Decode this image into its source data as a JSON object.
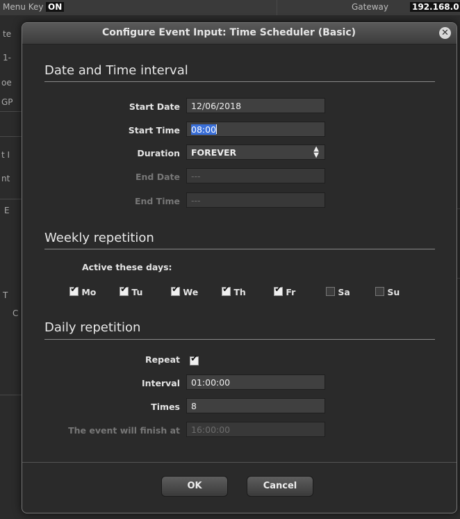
{
  "background": {
    "menu_key_label": "Menu Key",
    "menu_key_value": "ON",
    "gateway_label": "Gateway",
    "gateway_value": "192.168.0",
    "side_fragments": [
      "te",
      "1-",
      "oe",
      "GP",
      "t I",
      "nt",
      "E",
      "T",
      "C"
    ]
  },
  "dialog": {
    "title": "Configure Event Input: Time Scheduler (Basic)",
    "close_icon": "close-icon",
    "date_time": {
      "heading": "Date and Time interval",
      "start_date_label": "Start Date",
      "start_date_value": "12/06/2018",
      "start_time_label": "Start Time",
      "start_time_value": "08:00",
      "duration_label": "Duration",
      "duration_value": "FOREVER",
      "end_date_label": "End Date",
      "end_date_value": "---",
      "end_time_label": "End Time",
      "end_time_value": "---"
    },
    "weekly": {
      "heading": "Weekly repetition",
      "active_label": "Active these days:",
      "days": [
        {
          "label": "Mo",
          "checked": true
        },
        {
          "label": "Tu",
          "checked": true
        },
        {
          "label": "We",
          "checked": true
        },
        {
          "label": "Th",
          "checked": true
        },
        {
          "label": "Fr",
          "checked": true
        },
        {
          "label": "Sa",
          "checked": false
        },
        {
          "label": "Su",
          "checked": false
        }
      ]
    },
    "daily": {
      "heading": "Daily repetition",
      "repeat_label": "Repeat",
      "repeat_checked": true,
      "interval_label": "Interval",
      "interval_value": "01:00:00",
      "times_label": "Times",
      "times_value": "8",
      "finish_label": "The event will finish at",
      "finish_value": "16:00:00"
    },
    "buttons": {
      "ok": "OK",
      "cancel": "Cancel"
    }
  }
}
